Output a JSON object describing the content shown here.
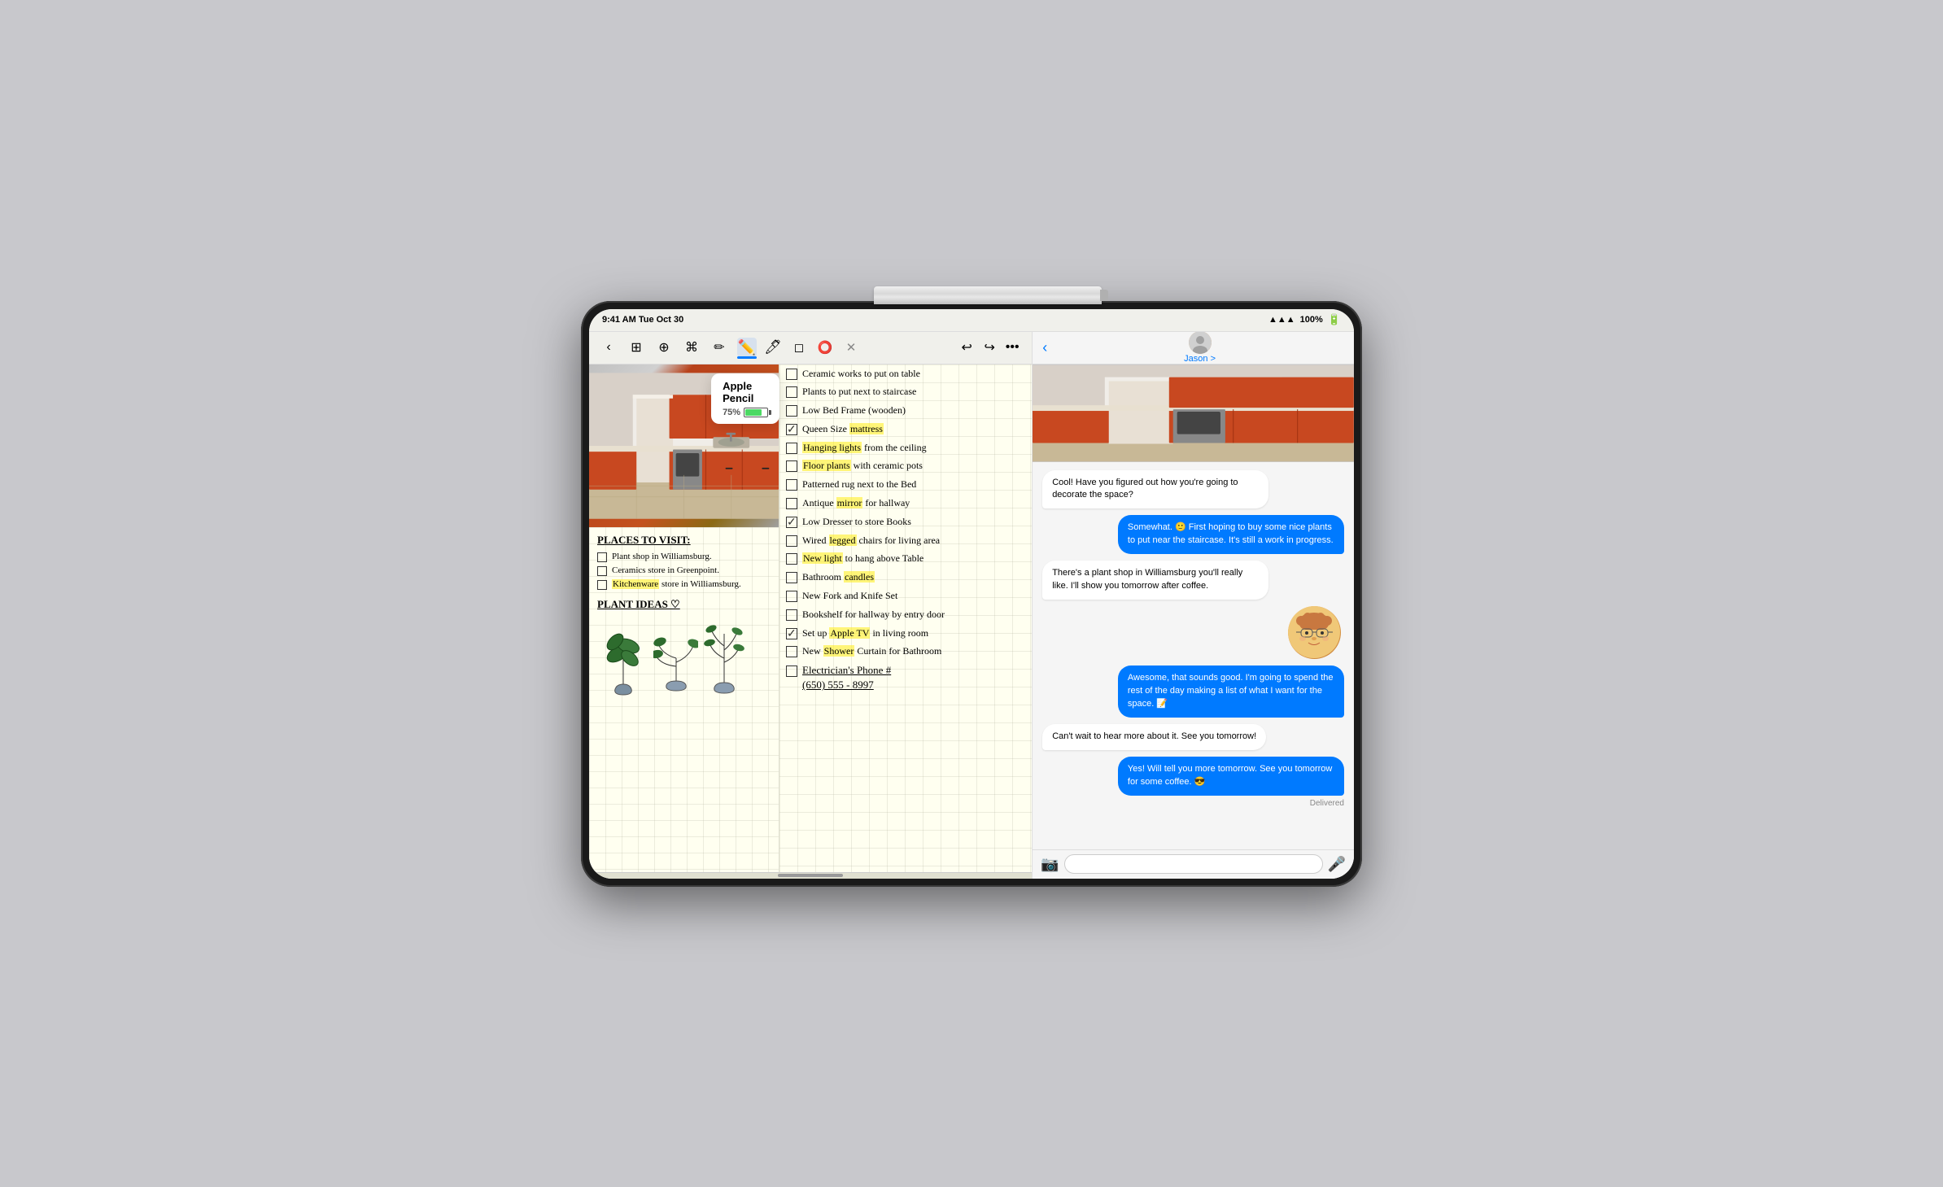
{
  "scene": {
    "bg_color": "#c8c8cc"
  },
  "status_bar_left": {
    "time": "9:41 AM  Tue Oct 30"
  },
  "status_bar_right": {
    "wifi": "WiFi",
    "battery": "100%"
  },
  "notes_toolbar": {
    "tools": [
      "back",
      "grid",
      "add",
      "lasso",
      "edit"
    ],
    "pencil_tool": "✏️",
    "marker_tool": "🖊",
    "eraser_tool": "⌫",
    "lasso_tool": "⭕",
    "close_tool": "✕",
    "undo_label": "↩",
    "redo_label": "↪",
    "more_label": "•••"
  },
  "pencil_popup": {
    "title": "Apple Pencil",
    "battery_percent": "75%",
    "battery_color": "#4cd964"
  },
  "places_section": {
    "title": "PLACES TO VISIT:",
    "items": [
      {
        "text": "Plant shop in Williamsburg.",
        "checked": false
      },
      {
        "text": "Ceramics store in Greenpoint.",
        "checked": false
      },
      {
        "text": "Kitchenware store in Williamsburg.",
        "checked": false,
        "highlight": "Kitchenware"
      }
    ]
  },
  "plant_ideas": {
    "title": "PLANT IDEAS ♡"
  },
  "checklist": {
    "items": [
      {
        "text": "Ceramic works to put on table",
        "checked": false
      },
      {
        "text": "Plants to put next to staircase",
        "checked": false
      },
      {
        "text": "Low Bed Frame (wooden)",
        "checked": false
      },
      {
        "text": "Queen Size mattress",
        "checked": true,
        "highlight": "mattress"
      },
      {
        "text": "Hanging lights from the ceiling",
        "checked": false,
        "highlight": "Hanging lights"
      },
      {
        "text": "Floor plants with ceramic pots",
        "checked": false,
        "highlight": "Floor plants"
      },
      {
        "text": "Patterned rug next to the Bed",
        "checked": false
      },
      {
        "text": "Antique mirror for hallway",
        "checked": false,
        "highlight": "mirror"
      },
      {
        "text": "Low Dresser to store Books",
        "checked": true
      },
      {
        "text": "Wired legged chairs for living area",
        "checked": false,
        "highlight": "legged"
      },
      {
        "text": "New light to hang above Table",
        "checked": false,
        "highlight": "New light"
      },
      {
        "text": "Bathroom candles",
        "checked": false,
        "highlight": "candles"
      },
      {
        "text": "New Fork and Knife Set",
        "checked": false
      },
      {
        "text": "Bookshelf for hallway by entry door",
        "checked": false
      },
      {
        "text": "Set up Apple TV in living room",
        "checked": true,
        "highlight": "Apple TV"
      },
      {
        "text": "New Shower Curtain for Bathroom",
        "checked": false,
        "highlight": "Shower"
      }
    ]
  },
  "electrician": {
    "label": "Electrician's Phone #",
    "number": "(650) 555 - 8997"
  },
  "messages": {
    "contact_name": "Jason",
    "contact_detail": "Jason >",
    "conversation": [
      {
        "type": "received",
        "text": "Cool! Have you figured out how you're going to decorate the space?"
      },
      {
        "type": "sent",
        "text": "Somewhat. 🙂 First hoping to buy some nice plants to put near the staircase. It's still a work in progress."
      },
      {
        "type": "received",
        "text": "There's a plant shop in Williamsburg you'll really like. I'll show you tomorrow after coffee."
      },
      {
        "type": "memoji"
      },
      {
        "type": "sent",
        "text": "Awesome, that sounds good. I'm going to spend the rest of the day making a list of what I want for the space. 📝"
      },
      {
        "type": "received",
        "text": "Can't wait to hear more about it. See you tomorrow!"
      },
      {
        "type": "sent",
        "text": "Yes! Will tell you more tomorrow. See you tomorrow for some coffee. 😎"
      }
    ],
    "delivered_label": "Delivered",
    "input_placeholder": ""
  }
}
